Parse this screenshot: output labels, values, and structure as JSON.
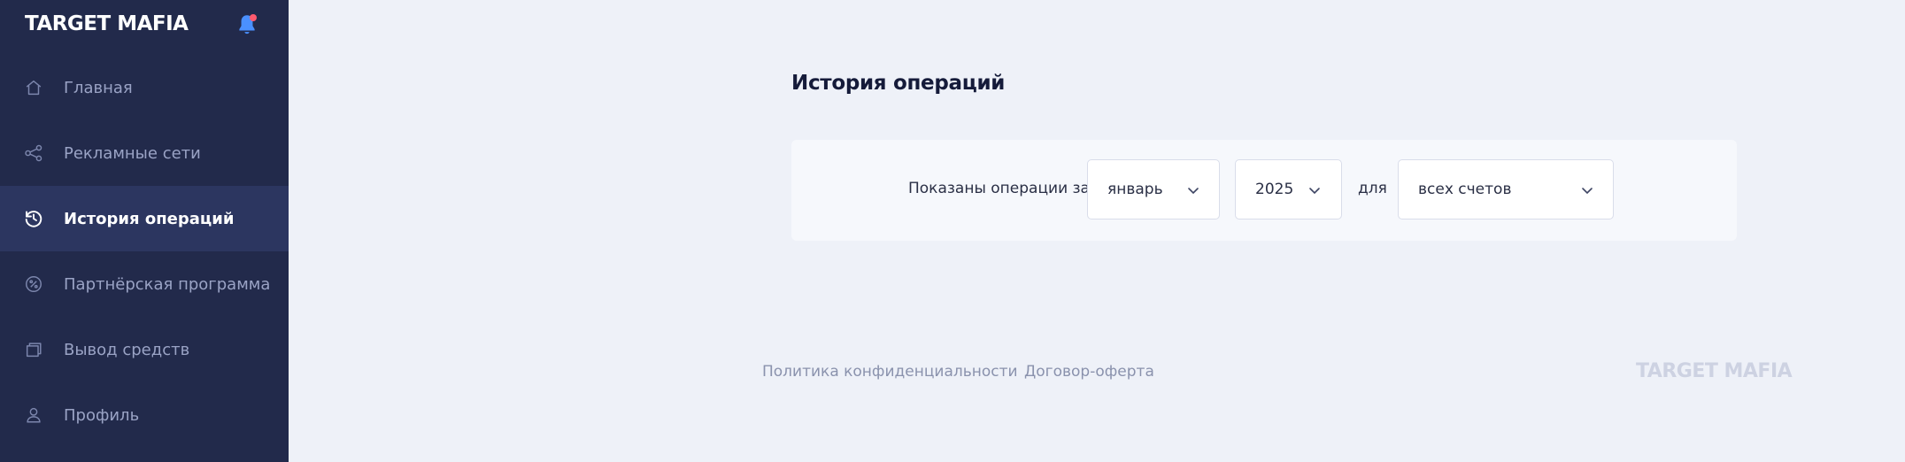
{
  "brand": "TARGET MAFIA",
  "nav": [
    {
      "label": "Главная",
      "icon": "home-icon",
      "active": false
    },
    {
      "label": "Рекламные сети",
      "icon": "share-icon",
      "active": false
    },
    {
      "label": "История операций",
      "icon": "history-icon",
      "active": true
    },
    {
      "label": "Партнёрская программа",
      "icon": "percent-icon",
      "active": false
    },
    {
      "label": "Вывод средств",
      "icon": "wallet-icon",
      "active": false
    },
    {
      "label": "Профиль",
      "icon": "user-icon",
      "active": false
    }
  ],
  "main": {
    "title": "История операций",
    "filter": {
      "prefix": "Показаны операции за",
      "month": "январь",
      "year": "2025",
      "connector": "для",
      "account": "всех счетов"
    }
  },
  "footer": {
    "privacy": "Политика конфиденциальности",
    "offer": "Договор-оферта",
    "brand": "TARGET MAFIA"
  },
  "colors": {
    "sidebar": "#222a4b",
    "sidebar_active": "#2c3660",
    "background": "#eef1f8",
    "bell": "#4a90ff",
    "bell_badge": "#ff5a6e"
  }
}
